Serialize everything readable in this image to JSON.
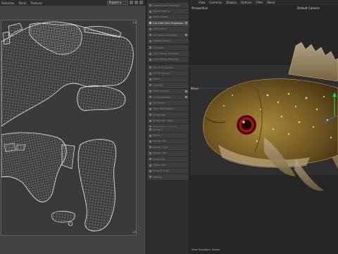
{
  "uv_editor": {
    "menu": [
      "Selection",
      "Panel",
      "Textures"
    ],
    "project_dropdown": "Project",
    "corner_top_right": "1.1",
    "corner_bottom_right": "1.0"
  },
  "tools": {
    "group1": [
      "Seams from Selection",
      "Select Seams",
      "Mesh Seams",
      "Cut UVW from Projection",
      "Add Seams",
      "UV Seam Functions",
      "Unfold Seams"
    ],
    "group2": [
      "UV Mode",
      "Quick Wrap Cascade",
      "Quick Wrap Mapping"
    ],
    "group3": [
      "Fit UV To Canvas",
      "Fit UV Islands",
      "Relax",
      "Optimal",
      "Scale Islands",
      "Fit Rectangles",
      "Fit Pattern",
      "Align Rectangles",
      "Straighten",
      "Straighten Rows",
      "Straighten Columns"
    ],
    "group4": [
      "Mirror U",
      "Mirror V",
      "Rotate CW",
      "Rotate CCW",
      "Rotate 180",
      "Scale UVs",
      "Offset UVs",
      "Snap To Grid",
      "Display"
    ],
    "highlight_index": 3
  },
  "viewport": {
    "menu": [
      "View",
      "Cameras",
      "Display",
      "Options",
      "Filter",
      "Panel"
    ],
    "label": "Perspective",
    "camera": "Default Camera",
    "move_label": "Move",
    "footer": "View Transform: Scene"
  },
  "colors": {
    "uv_wire": "#e8e8e8",
    "fish_body": "#8a6a2a",
    "fish_eye": "#b21a1a",
    "accent_green": "#24d24a",
    "accent_red": "#d23a2a"
  }
}
